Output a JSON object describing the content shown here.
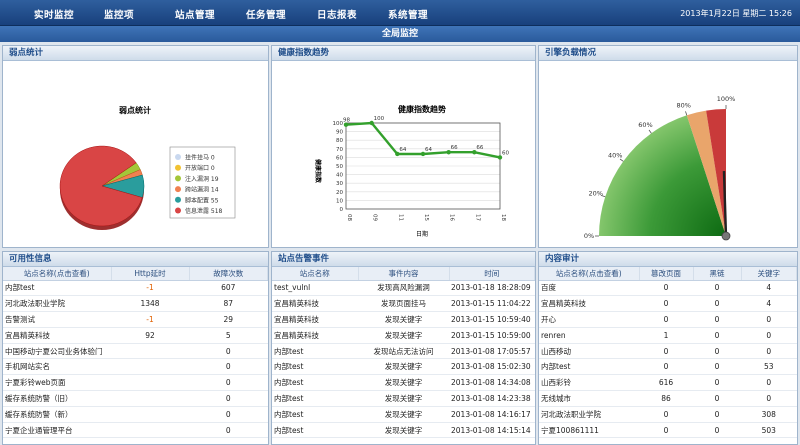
{
  "nav": {
    "items": [
      "实时监控",
      "监控项",
      "站点管理",
      "任务管理",
      "日志报表",
      "系统管理"
    ],
    "datetime": "2013年1月22日 星期二 15:26"
  },
  "subtitle": "全局监控",
  "panels": {
    "weak": {
      "title": "弱点统计",
      "chart_title": "弱点统计"
    },
    "health": {
      "title": "健康指数趋势",
      "chart_title": "健康指数趋势",
      "xlabel": "日期",
      "ylabel": "健康指数"
    },
    "engine": {
      "title": "引擎负载情况"
    },
    "avail": {
      "title": "可用性信息",
      "headers": [
        "站点名称(点击查看)",
        "Http延时",
        "故障次数"
      ]
    },
    "alerts": {
      "title": "站点告警事件",
      "headers": [
        "站点名称",
        "事件内容",
        "时间"
      ]
    },
    "audit": {
      "title": "内容审计",
      "headers": [
        "站点名称(点击查看)",
        "篡改页面",
        "黑链",
        "关键字"
      ]
    }
  },
  "colors": {
    "pie": [
      "#c9d8ef",
      "#f1c232",
      "#a4c639",
      "#f08050",
      "#2a9d9d",
      "#d94545"
    ],
    "series": "#33a02c"
  },
  "chart_data": [
    {
      "type": "pie",
      "title": "弱点统计",
      "series": [
        {
          "name": "挂件挂马",
          "value": 0
        },
        {
          "name": "开放端口",
          "value": 0
        },
        {
          "name": "注入漏洞",
          "value": 19
        },
        {
          "name": "跨站漏洞",
          "value": 14
        },
        {
          "name": "脚本配置",
          "value": 55
        },
        {
          "name": "信息泄露",
          "value": 518
        }
      ]
    },
    {
      "type": "line",
      "title": "健康指数趋势",
      "xlabel": "日期",
      "ylabel": "健康指数",
      "x": [
        "08",
        "09",
        "11",
        "15",
        "16",
        "17",
        "18"
      ],
      "values": [
        98,
        100,
        64,
        64,
        66,
        66,
        60
      ],
      "ylim": [
        0,
        100
      ],
      "yticks": [
        0,
        10,
        20,
        30,
        40,
        50,
        60,
        70,
        80,
        90,
        100
      ],
      "grid": true
    },
    {
      "type": "gauge",
      "ticks": [
        "0%",
        "20%",
        "40%",
        "60%",
        "80%",
        "100%"
      ],
      "value": 98
    }
  ],
  "availability": [
    [
      "内部test",
      "-1",
      "607"
    ],
    [
      "河北政法职业学院",
      "1348",
      "87"
    ],
    [
      "告警测试",
      "-1",
      "29"
    ],
    [
      "宜昌精英科技",
      "92",
      "5"
    ],
    [
      "中国移动宁夏公司业务体验门",
      "",
      "0"
    ],
    [
      "手机网站实名",
      "",
      "0"
    ],
    [
      "宁夏彩铃web页面",
      "",
      "0"
    ],
    [
      "缓存系统防警（旧）",
      "",
      "0"
    ],
    [
      "缓存系统防警（新）",
      "",
      "0"
    ],
    [
      "宁夏企业通管理平台",
      "",
      "0"
    ]
  ],
  "alertRows": [
    [
      "test_vulnl",
      "发现高风险漏洞",
      "2013-01-18 18:28:09"
    ],
    [
      "宜昌精英科技",
      "发现页面挂马",
      "2013-01-15 11:04:22"
    ],
    [
      "宜昌精英科技",
      "发现关键字",
      "2013-01-15 10:59:40"
    ],
    [
      "宜昌精英科技",
      "发现关键字",
      "2013-01-15 10:59:00"
    ],
    [
      "内部test",
      "发现站点无法访问",
      "2013-01-08 17:05:57"
    ],
    [
      "内部test",
      "发现关键字",
      "2013-01-08 15:02:30"
    ],
    [
      "内部test",
      "发现关键字",
      "2013-01-08 14:34:08"
    ],
    [
      "内部test",
      "发现关键字",
      "2013-01-08 14:23:38"
    ],
    [
      "内部test",
      "发现关键字",
      "2013-01-08 14:16:17"
    ],
    [
      "内部test",
      "发现关键字",
      "2013-01-08 14:15:14"
    ]
  ],
  "auditRows": [
    [
      "百度",
      "0",
      "0",
      "4"
    ],
    [
      "宜昌精英科技",
      "0",
      "0",
      "4"
    ],
    [
      "开心",
      "0",
      "0",
      "0"
    ],
    [
      "renren",
      "1",
      "0",
      "0"
    ],
    [
      "山西移动",
      "0",
      "0",
      "0"
    ],
    [
      "内部test",
      "0",
      "0",
      "53"
    ],
    [
      "山西彩铃",
      "616",
      "0",
      "0"
    ],
    [
      "无线城市",
      "86",
      "0",
      "0"
    ],
    [
      "河北政法职业学院",
      "0",
      "0",
      "308"
    ],
    [
      "宁夏100861111",
      "0",
      "0",
      "503"
    ]
  ]
}
